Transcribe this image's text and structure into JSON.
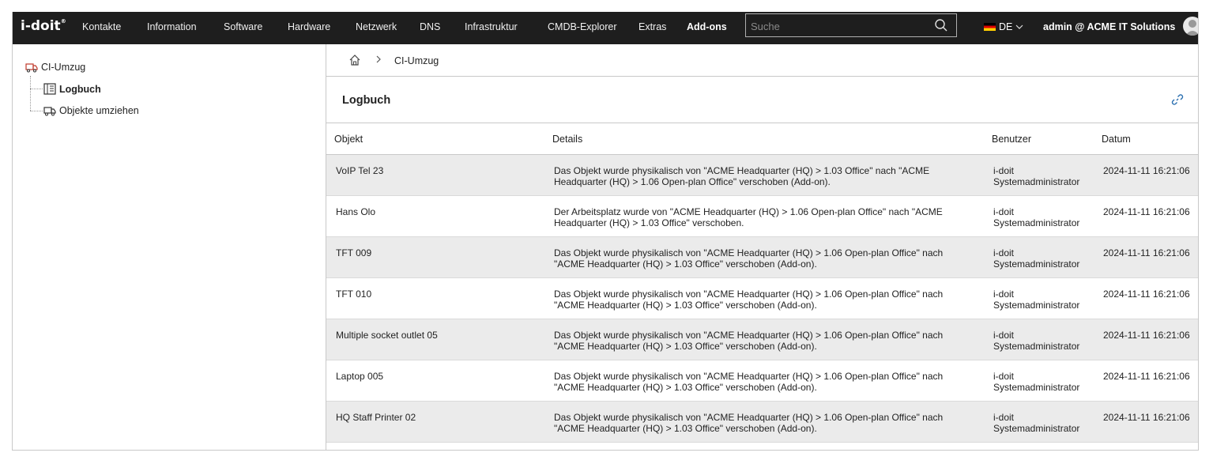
{
  "app": {
    "logo": "i-doit",
    "logo_mark": "®"
  },
  "nav": {
    "items": [
      "Kontakte",
      "Information",
      "Software",
      "Hardware",
      "Netzwerk",
      "DNS",
      "Infrastruktur",
      "CMDB-Explorer",
      "Extras",
      "Add-ons"
    ],
    "active": "Add-ons"
  },
  "search": {
    "placeholder": "Suche",
    "value": ""
  },
  "language": {
    "code": "DE"
  },
  "user": {
    "label": "admin @ ACME IT Solutions"
  },
  "tree": {
    "root": "CI-Umzug",
    "children": [
      "Logbuch",
      "Objekte umziehen"
    ],
    "selected": "Logbuch"
  },
  "breadcrumb": {
    "current": "CI-Umzug"
  },
  "section": {
    "title": "Logbuch"
  },
  "table": {
    "headers": [
      "Objekt",
      "Details",
      "Benutzer",
      "Datum"
    ],
    "rows": [
      {
        "objekt": "VoIP Tel 23",
        "details": "Das Objekt wurde physikalisch von \"ACME Headquarter (HQ) > 1.03 Office\" nach \"ACME Headquarter (HQ) > 1.06 Open-plan Office\" verschoben (Add-on).",
        "benutzer": "i-doit Systemadministrator",
        "datum": "2024-11-11 16:21:06"
      },
      {
        "objekt": "Hans Olo",
        "details": "Der Arbeitsplatz wurde von \"ACME Headquarter (HQ) > 1.06 Open-plan Office\" nach \"ACME Headquarter (HQ) > 1.03 Office\" verschoben.",
        "benutzer": "i-doit Systemadministrator",
        "datum": "2024-11-11 16:21:06"
      },
      {
        "objekt": "TFT 009",
        "details": "Das Objekt wurde physikalisch von \"ACME Headquarter (HQ) > 1.06 Open-plan Office\" nach \"ACME Headquarter (HQ) > 1.03 Office\" verschoben (Add-on).",
        "benutzer": "i-doit Systemadministrator",
        "datum": "2024-11-11 16:21:06"
      },
      {
        "objekt": "TFT 010",
        "details": "Das Objekt wurde physikalisch von \"ACME Headquarter (HQ) > 1.06 Open-plan Office\" nach \"ACME Headquarter (HQ) > 1.03 Office\" verschoben (Add-on).",
        "benutzer": "i-doit Systemadministrator",
        "datum": "2024-11-11 16:21:06"
      },
      {
        "objekt": "Multiple socket outlet 05",
        "details": "Das Objekt wurde physikalisch von \"ACME Headquarter (HQ) > 1.06 Open-plan Office\" nach \"ACME Headquarter (HQ) > 1.03 Office\" verschoben (Add-on).",
        "benutzer": "i-doit Systemadministrator",
        "datum": "2024-11-11 16:21:06"
      },
      {
        "objekt": "Laptop 005",
        "details": "Das Objekt wurde physikalisch von \"ACME Headquarter (HQ) > 1.06 Open-plan Office\" nach \"ACME Headquarter (HQ) > 1.03 Office\" verschoben (Add-on).",
        "benutzer": "i-doit Systemadministrator",
        "datum": "2024-11-11 16:21:06"
      },
      {
        "objekt": "HQ Staff Printer 02",
        "details": "Das Objekt wurde physikalisch von \"ACME Headquarter (HQ) > 1.06 Open-plan Office\" nach \"ACME Headquarter (HQ) > 1.03 Office\" verschoben (Add-on).",
        "benutzer": "i-doit Systemadministrator",
        "datum": "2024-11-11 16:21:06"
      }
    ]
  },
  "colors": {
    "topbar": "#1e1e1e",
    "row_alt": "#ebebeb",
    "accent_link": "#2a6fb0",
    "tree_icon": "#c0392b"
  }
}
